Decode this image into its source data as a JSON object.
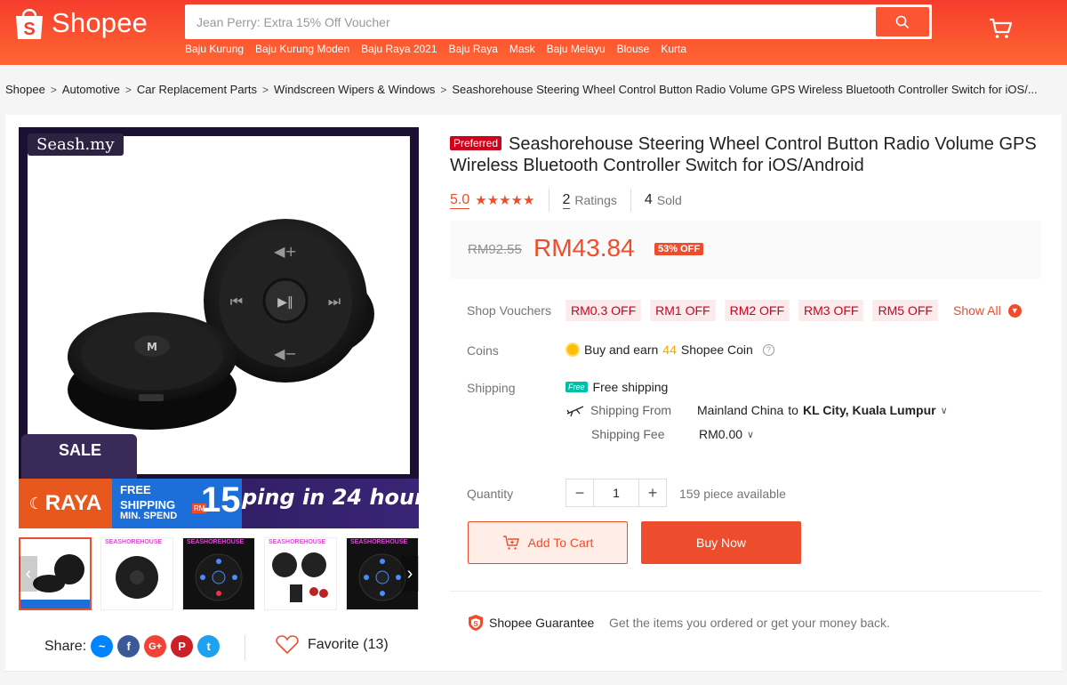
{
  "header": {
    "logo_text": "Shopee",
    "search_placeholder": "Jean Perry: Extra 15% Off Voucher",
    "suggestions": [
      "Baju Kurung",
      "Baju Kurung Moden",
      "Baju Raya 2021",
      "Baju Raya",
      "Mask",
      "Baju Melayu",
      "Blouse",
      "Kurta"
    ]
  },
  "breadcrumb": [
    "Shopee",
    "Automotive",
    "Car Replacement Parts",
    "Windscreen Wipers & Windows",
    "Seashorehouse Steering Wheel Control Button Radio Volume GPS Wireless Bluetooth Controller Switch for iOS/..."
  ],
  "gallery": {
    "brand_tag": "Seash.my",
    "sale_text": "SALE",
    "raya_text": "RAYA",
    "free_line1": "FREE",
    "free_line2": "SHIPPING",
    "free_line3": "MIN. SPEND",
    "free_num": "15",
    "free_rm": "RM",
    "ship24": "ping in 24 hours",
    "thumb_label": "SEASHOREHOUSE",
    "thumb_count": 5
  },
  "share": {
    "label": "Share:",
    "favorite": "Favorite (13)"
  },
  "product": {
    "preferred_badge": "Preferred",
    "title": "Seashorehouse Steering Wheel Control Button Radio Volume GPS Wireless Bluetooth Controller Switch for iOS/Android",
    "rating": "5.0",
    "rating_value": 5,
    "ratings_count": "2",
    "ratings_label": "Ratings",
    "sold_count": "4",
    "sold_label": "Sold",
    "old_price": "RM92.55",
    "price": "RM43.84",
    "discount": "53% OFF"
  },
  "details": {
    "vouchers_label": "Shop Vouchers",
    "vouchers": [
      "RM0.3 OFF",
      "RM1 OFF",
      "RM2 OFF",
      "RM3 OFF",
      "RM5 OFF"
    ],
    "show_all": "Show All",
    "coins_label": "Coins",
    "coins_text_1": "Buy and earn",
    "coins_amount": "44",
    "coins_text_2": "Shopee Coin",
    "shipping_label": "Shipping",
    "free_tag": "Free",
    "free_shipping": "Free shipping",
    "shipping_from_label": "Shipping From",
    "shipping_from_origin": "Mainland China",
    "shipping_from_to": "to",
    "shipping_from_dest": "KL City, Kuala Lumpur",
    "shipping_fee_label": "Shipping Fee",
    "shipping_fee": "RM0.00",
    "quantity_label": "Quantity",
    "quantity": "1",
    "available": "159 piece available",
    "add_to_cart": "Add To Cart",
    "buy_now": "Buy Now",
    "guarantee_title": "Shopee Guarantee",
    "guarantee_text": "Get the items you ordered or get your money back."
  },
  "colors": {
    "brand": "#ee4d2d",
    "header": "#f53d2d"
  }
}
